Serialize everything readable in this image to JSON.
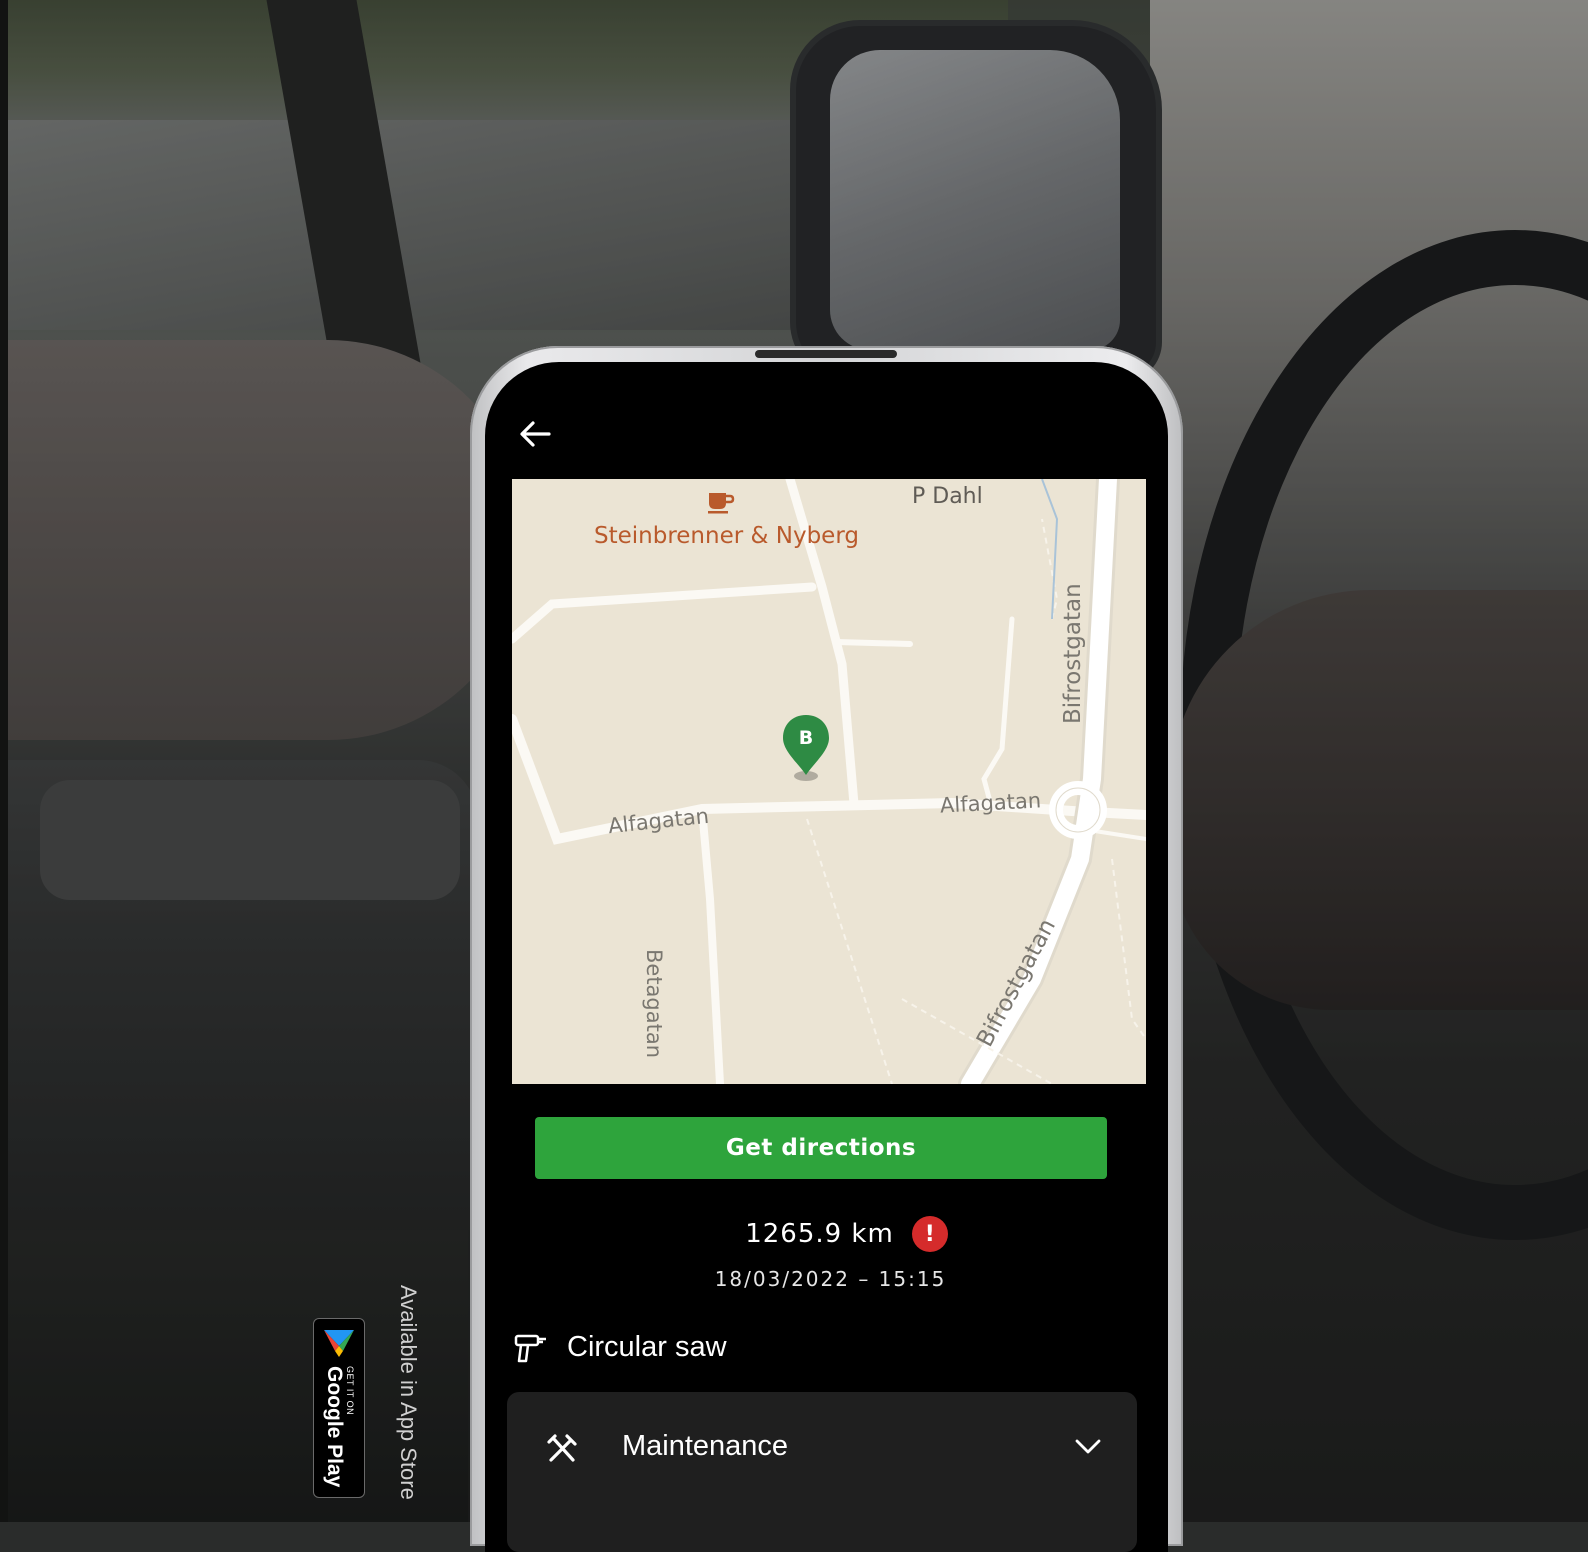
{
  "map": {
    "poi_name": "Steinbrenner & Nyberg",
    "poi_icon": "coffee-cup-icon",
    "place_label": "P Dahl",
    "streets": [
      "Alfagatan",
      "Alfagatan",
      "Betagatan",
      "Bifrostgatan",
      "Bifrostgatan"
    ],
    "marker_letter": "B",
    "marker_color": "#2e8b44"
  },
  "actions": {
    "directions_label": "Get directions",
    "directions_color": "#2ea43c"
  },
  "info": {
    "distance": "1265.9 km",
    "warning_glyph": "!",
    "datetime": "18/03/2022 – 15:15"
  },
  "tool": {
    "name": "Circular saw",
    "icon": "drill-icon"
  },
  "section": {
    "label": "Maintenance",
    "icon": "tools-icon",
    "expand_icon": "chevron-down-icon"
  },
  "badges": {
    "google_small": "GET IT ON",
    "google_big": "Google Play",
    "appstore": "Available in App Store"
  }
}
